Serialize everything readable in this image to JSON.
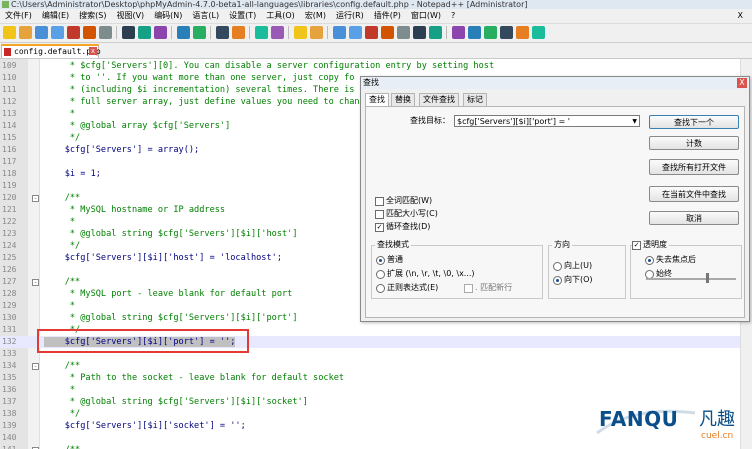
{
  "window": {
    "title": "C:\\Users\\Administrator\\Desktop\\phpMyAdmin-4.7.0-beta1-all-languages\\libraries\\config.default.php - Notepad++ [Administrator]"
  },
  "menu": [
    "文件(F)",
    "编辑(E)",
    "搜索(S)",
    "视图(V)",
    "编码(N)",
    "语言(L)",
    "设置(T)",
    "工具(O)",
    "宏(M)",
    "运行(R)",
    "插件(P)",
    "窗口(W)",
    "?"
  ],
  "menu_close": "X",
  "toolbar_icons": [
    "new-file-icon",
    "open-file-icon",
    "save-icon",
    "save-all-icon",
    "close-icon",
    "close-all-icon",
    "print-icon",
    "cut-icon",
    "copy-icon",
    "paste-icon",
    "undo-icon",
    "redo-icon",
    "find-icon",
    "replace-icon",
    "zoom-in-icon",
    "zoom-out-icon",
    "sync-v-icon",
    "sync-h-icon",
    "word-wrap-icon",
    "all-chars-icon",
    "indent-guide-icon",
    "udl-icon",
    "doc-map-icon",
    "function-list-icon",
    "folder-icon",
    "monitor-icon",
    "record-macro-icon",
    "stop-macro-icon",
    "play-macro-icon",
    "run-macro-icon",
    "save-macro-icon"
  ],
  "tab": {
    "label": "config.default.php"
  },
  "editor": {
    "lines": [
      {
        "n": "109",
        "t": "     * $cfg['Servers'][0]. You can disable a server configuration entry by setting host",
        "c": "cm"
      },
      {
        "n": "110",
        "t": "     * to ''. If you want more than one server, just copy fo",
        "c": "cm"
      },
      {
        "n": "111",
        "t": "     * (including $i incrementation) several times. There is",
        "c": "cm"
      },
      {
        "n": "112",
        "t": "     * full server array, just define values you need to chan",
        "c": "cm"
      },
      {
        "n": "113",
        "t": "     *",
        "c": "cm"
      },
      {
        "n": "114",
        "t": "     * @global array $cfg['Servers']",
        "c": "cm"
      },
      {
        "n": "115",
        "t": "     */",
        "c": "cm"
      },
      {
        "n": "116",
        "t": "    $cfg['Servers'] = array();",
        "c": "kw"
      },
      {
        "n": "117",
        "t": "",
        "c": "kw"
      },
      {
        "n": "118",
        "t": "    $i = 1;",
        "c": "kw"
      },
      {
        "n": "119",
        "t": "",
        "c": "kw"
      },
      {
        "n": "120",
        "t": "    /**",
        "c": "cm",
        "fold": "-"
      },
      {
        "n": "121",
        "t": "     * MySQL hostname or IP address",
        "c": "cm"
      },
      {
        "n": "122",
        "t": "     *",
        "c": "cm"
      },
      {
        "n": "123",
        "t": "     * @global string $cfg['Servers'][$i]['host']",
        "c": "cm"
      },
      {
        "n": "124",
        "t": "     */",
        "c": "cm"
      },
      {
        "n": "125",
        "t": "    $cfg['Servers'][$i]['host'] = 'localhost';",
        "c": "kw"
      },
      {
        "n": "126",
        "t": "",
        "c": "kw"
      },
      {
        "n": "127",
        "t": "    /**",
        "c": "cm",
        "fold": "-"
      },
      {
        "n": "128",
        "t": "     * MySQL port - leave blank for default port",
        "c": "cm"
      },
      {
        "n": "129",
        "t": "     *",
        "c": "cm"
      },
      {
        "n": "130",
        "t": "     * @global string $cfg['Servers'][$i]['port']",
        "c": "cm"
      },
      {
        "n": "131",
        "t": "     */",
        "c": "cm"
      },
      {
        "n": "132",
        "t": "    $cfg['Servers'][$i]['port'] = '';",
        "c": "kw",
        "hl": true
      },
      {
        "n": "133",
        "t": "",
        "c": "kw"
      },
      {
        "n": "134",
        "t": "    /**",
        "c": "cm",
        "fold": "-"
      },
      {
        "n": "135",
        "t": "     * Path to the socket - leave blank for default socket",
        "c": "cm"
      },
      {
        "n": "136",
        "t": "     *",
        "c": "cm"
      },
      {
        "n": "137",
        "t": "     * @global string $cfg['Servers'][$i]['socket']",
        "c": "cm"
      },
      {
        "n": "138",
        "t": "     */",
        "c": "cm"
      },
      {
        "n": "139",
        "t": "    $cfg['Servers'][$i]['socket'] = '';",
        "c": "kw"
      },
      {
        "n": "140",
        "t": "",
        "c": "kw"
      },
      {
        "n": "141",
        "t": "    /**",
        "c": "cm",
        "fold": "-"
      }
    ]
  },
  "find_dialog": {
    "title": "查找",
    "close": "X",
    "tabs": [
      "查找",
      "替换",
      "文件查找",
      "标记"
    ],
    "find_label": "查找目标：",
    "find_value": "$cfg['Servers'][$i]['port'] = '",
    "buttons": [
      "查找下一个",
      "计数",
      "查找所有打开文件",
      "在当前文件中查找",
      "取消"
    ],
    "checkboxes": [
      {
        "label": "全词匹配(W)",
        "checked": false
      },
      {
        "label": "匹配大小写(C)",
        "checked": false
      },
      {
        "label": "循环查找(D)",
        "checked": true
      }
    ],
    "search_mode": {
      "title": "查找模式",
      "options": [
        {
          "label": "普通",
          "checked": true
        },
        {
          "label": "扩展 (\\n, \\r, \\t, \\0, \\x...)",
          "checked": false
        },
        {
          "label": "正则表达式(E)",
          "checked": false
        }
      ],
      "dot_newline": ". 匹配新行"
    },
    "direction": {
      "title": "方向",
      "options": [
        {
          "label": "向上(U)",
          "checked": false
        },
        {
          "label": "向下(O)",
          "checked": true
        }
      ]
    },
    "transparency": {
      "title": "透明度",
      "checked": true,
      "options": [
        {
          "label": "失去焦点后",
          "checked": true
        },
        {
          "label": "始终",
          "checked": false
        }
      ]
    }
  },
  "watermark": {
    "brand": "FANQU",
    "brand_cn": "凡趣",
    "url": "cuel.cn"
  },
  "colors": {
    "comment": "#008000",
    "code": "#000080",
    "highlight_box": "#e53935",
    "tab_accent": "#f5a623"
  }
}
